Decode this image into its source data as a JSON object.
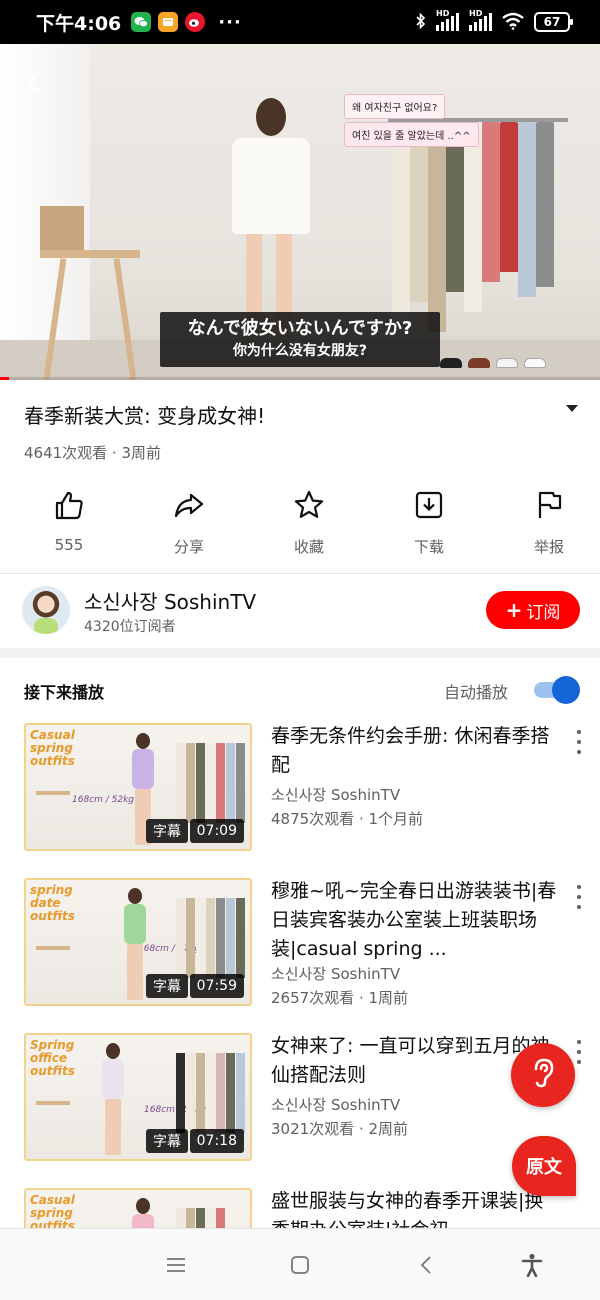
{
  "status_bar": {
    "time": "下午4:06",
    "dots": "···",
    "battery": "67",
    "hd1": "HD",
    "hd2": "HD",
    "apps": [
      "wechat-icon",
      "note-icon",
      "weibo-icon"
    ]
  },
  "player": {
    "subtitle_jp": "なんで彼女いないんですか?",
    "subtitle_cn": "你为什么没有女朋友?",
    "overlay_ko_1": "왜 여자친구 없어요?",
    "overlay_ko_2": "여친 있을 줄 알았는데 ..^^",
    "progress": 0.015
  },
  "video": {
    "title": "春季新装大赏: 变身成女神!",
    "meta": "4641次观看 · 3周前"
  },
  "actions": [
    {
      "label": "555",
      "icon": "thumbs-up-icon"
    },
    {
      "label": "分享",
      "icon": "share-icon"
    },
    {
      "label": "收藏",
      "icon": "star-icon"
    },
    {
      "label": "下载",
      "icon": "download-icon"
    },
    {
      "label": "举报",
      "icon": "flag-icon"
    }
  ],
  "channel": {
    "name": "소신사장 SoshinTV",
    "subs": "4320位订阅者",
    "subscribe": "订阅",
    "plus": "+"
  },
  "upnext": {
    "title": "接下来播放",
    "autoplay_label": "自动播放",
    "autoplay_on": true
  },
  "list": [
    {
      "title": "春季无条件约会手册: 休闲春季搭配",
      "channel": "소신사장 SoshinTV",
      "meta": "4875次观看 · 1个月前",
      "cc": "字幕",
      "duration": "07:09",
      "thumb_tag": "Casual spring outfits",
      "thumb_size": "168cm / 52kg",
      "outfit_color": "#c9b3e6"
    },
    {
      "title": "穆雅~吼~完全春日出游装装书|春日装宾客装办公室装上班装职场装|casual spring ...",
      "channel": "소신사장 SoshinTV",
      "meta": "2657次观看 · 1周前",
      "cc": "字幕",
      "duration": "07:59",
      "thumb_tag": "spring date outfits",
      "thumb_size": "168cm / 52kg",
      "outfit_color": "#9fd69a"
    },
    {
      "title": "女神来了: 一直可以穿到五月的神仙搭配法则",
      "channel": "소신사장 SoshinTV",
      "meta": "3021次观看 · 2周前",
      "cc": "字幕",
      "duration": "07:18",
      "thumb_tag": "Spring office outfits",
      "thumb_size": "168cm / 52kg",
      "outfit_color": "#e9e3ee"
    },
    {
      "title": "盛世服装与女神的春季开课装|换季期办公室装|社会初",
      "thumb_tag": "Casual spring outfits",
      "outfit_color": "#f1b8c9"
    }
  ],
  "floating": {
    "source_label": "原文",
    "ear_icon": "ear-icon"
  },
  "nav_bar": {
    "icons": [
      "menu-icon",
      "home-icon",
      "back-icon",
      "accessibility-icon"
    ]
  },
  "colors": {
    "accent_red": "#ff0000",
    "toggle_blue": "#1565d8",
    "thumb_border": "#f3d28c"
  }
}
